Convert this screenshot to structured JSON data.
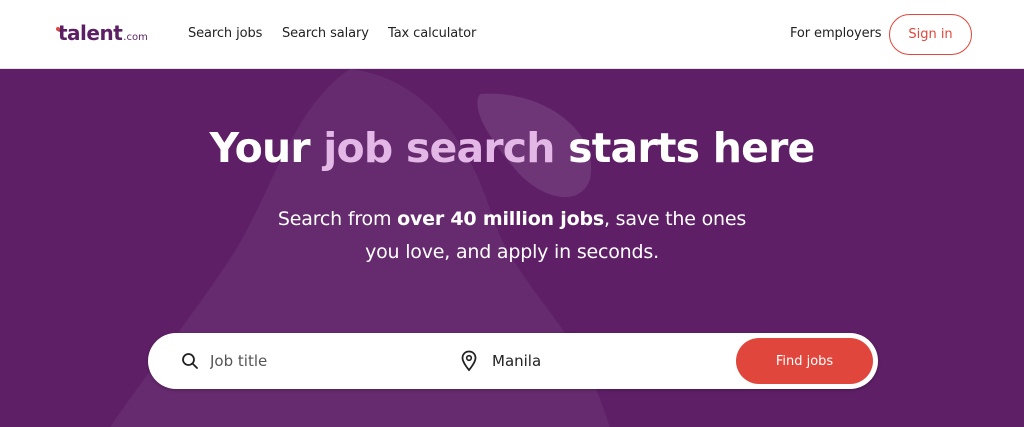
{
  "brand": {
    "logo_word": "talent",
    "logo_suffix": ".com",
    "accent_color": "#e0463b",
    "brand_color": "#5e1f66"
  },
  "nav": {
    "links": [
      "Search jobs",
      "Search salary",
      "Tax calculator"
    ],
    "employers": "For employers",
    "signin": "Sign in"
  },
  "hero": {
    "headline_start": "Your ",
    "headline_accent": "job search",
    "headline_end": " starts here",
    "sub_line1_pre": "Search from ",
    "sub_line1_bold": "over 40 million jobs",
    "sub_line1_post": ", save the ones",
    "sub_line2": "you love, and apply in seconds."
  },
  "search": {
    "job_placeholder": "Job title",
    "job_value": "",
    "location_value": "Manila",
    "submit_label": "Find jobs",
    "search_icon": "search-icon",
    "location_icon": "location-pin-icon"
  }
}
